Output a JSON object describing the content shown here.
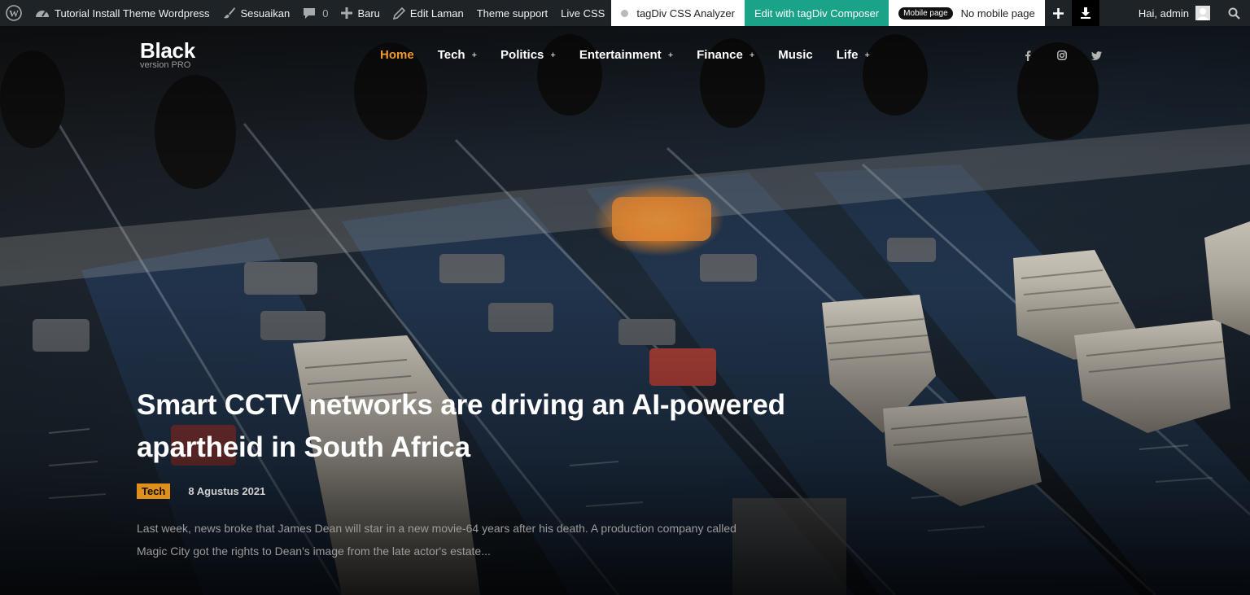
{
  "admin_bar": {
    "site_name": "Tutorial Install Theme Wordpress",
    "customize": "Sesuaikan",
    "comments_count": "0",
    "new": "Baru",
    "edit_page": "Edit Laman",
    "theme_support": "Theme support",
    "live_css": "Live CSS",
    "css_analyzer": "tagDiv CSS Analyzer",
    "composer": "Edit with tagDiv Composer",
    "mobile_pill": "Mobile page",
    "mobile_status": "No mobile page",
    "greeting": "Hai, admin",
    "icons": [
      "wordpress-icon",
      "dashboard-icon",
      "brush-icon",
      "comment-icon",
      "plus-icon",
      "pencil-icon",
      "download-icon",
      "search-icon"
    ]
  },
  "site": {
    "title": "Black",
    "tagline": "version PRO"
  },
  "nav": {
    "items": [
      {
        "label": "Home",
        "active": true,
        "has_sub": false
      },
      {
        "label": "Tech",
        "active": false,
        "has_sub": true
      },
      {
        "label": "Politics",
        "active": false,
        "has_sub": true
      },
      {
        "label": "Entertainment",
        "active": false,
        "has_sub": true
      },
      {
        "label": "Finance",
        "active": false,
        "has_sub": true
      },
      {
        "label": "Music",
        "active": false,
        "has_sub": false
      },
      {
        "label": "Life",
        "active": false,
        "has_sub": true
      }
    ],
    "sub_marker": "+",
    "social": [
      "facebook-icon",
      "instagram-icon",
      "twitter-icon"
    ]
  },
  "post": {
    "title": "Smart CCTV networks are driving an AI-powered apartheid in South Africa",
    "category": "Tech",
    "date": "8 Agustus 2021",
    "excerpt": "Last week, news broke that James Dean will star in a new movie-64 years after his death. A production company called Magic City got the rights to Dean's image from the late actor's estate..."
  },
  "colors": {
    "accent": "#f29a26",
    "admin_bar": "#1d2327",
    "composer_bg": "#1aa389",
    "category_bg": "#de8f1c"
  }
}
